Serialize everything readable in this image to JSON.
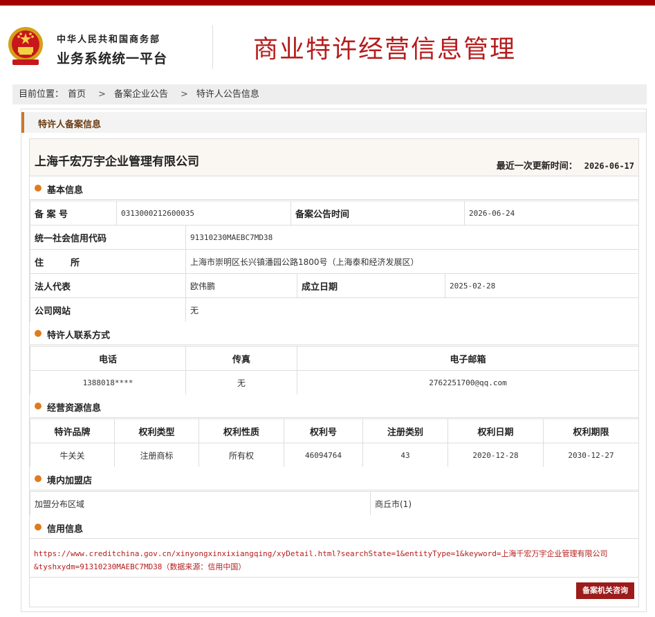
{
  "header": {
    "org_line1": "中华人民共和国商务部",
    "org_line2": "业务系统统一平台",
    "system_title": "商业特许经营信息管理"
  },
  "breadcrumb": {
    "prefix": "目前位置：",
    "items": [
      "首页",
      "备案企业公告",
      "特许人公告信息"
    ]
  },
  "panel": {
    "title": "特许人备案信息"
  },
  "company": {
    "name": "上海千宏万宇企业管理有限公司",
    "update_label": "最近一次更新时间：",
    "update_value": "2026-06-17"
  },
  "basic": {
    "title": "基本信息",
    "filing_no_label": "备 案 号",
    "filing_no": "0313000212600035",
    "announce_label": "备案公告时间",
    "announce_date": "2026-06-24",
    "credit_code_label": "统一社会信用代码",
    "credit_code": "91310230MAEBC7MD38",
    "address_label": "住　　　所",
    "address": "上海市崇明区长兴镇潘园公路1800号（上海泰和经济发展区）",
    "legal_label": "法人代表",
    "legal": "欧伟鹏",
    "founded_label": "成立日期",
    "founded": "2025-02-28",
    "website_label": "公司网站",
    "website": "无"
  },
  "contact": {
    "title": "特许人联系方式",
    "headers": [
      "电话",
      "传真",
      "电子邮箱"
    ],
    "row": [
      "1388018****",
      "无",
      "2762251700@qq.com"
    ]
  },
  "resources": {
    "title": "经营资源信息",
    "headers": [
      "特许品牌",
      "权利类型",
      "权利性质",
      "权利号",
      "注册类别",
      "权利日期",
      "权利期限"
    ],
    "row": [
      "牛关关",
      "注册商标",
      "所有权",
      "46094764",
      "43",
      "2020-12-28",
      "2030-12-27"
    ]
  },
  "franchise": {
    "title": "境内加盟店",
    "label": "加盟分布区域",
    "value": "商丘市(1)"
  },
  "credit": {
    "title": "信用信息",
    "line1": "https://www.creditchina.gov.cn/xinyongxinxixiangqing/xyDetail.html?searchState=1&entityType=1&keyword=上海千宏万宇企业管理有限公司",
    "line2": "&tyshxydm=91310230MAEBC7MD38（数据来源：信用中国）"
  },
  "actions": {
    "consult_button": "备案机关咨询"
  },
  "colors": {
    "brand_red": "#b51c1c",
    "accent_orange": "#e07a1f",
    "button_red": "#9c1b1b"
  }
}
